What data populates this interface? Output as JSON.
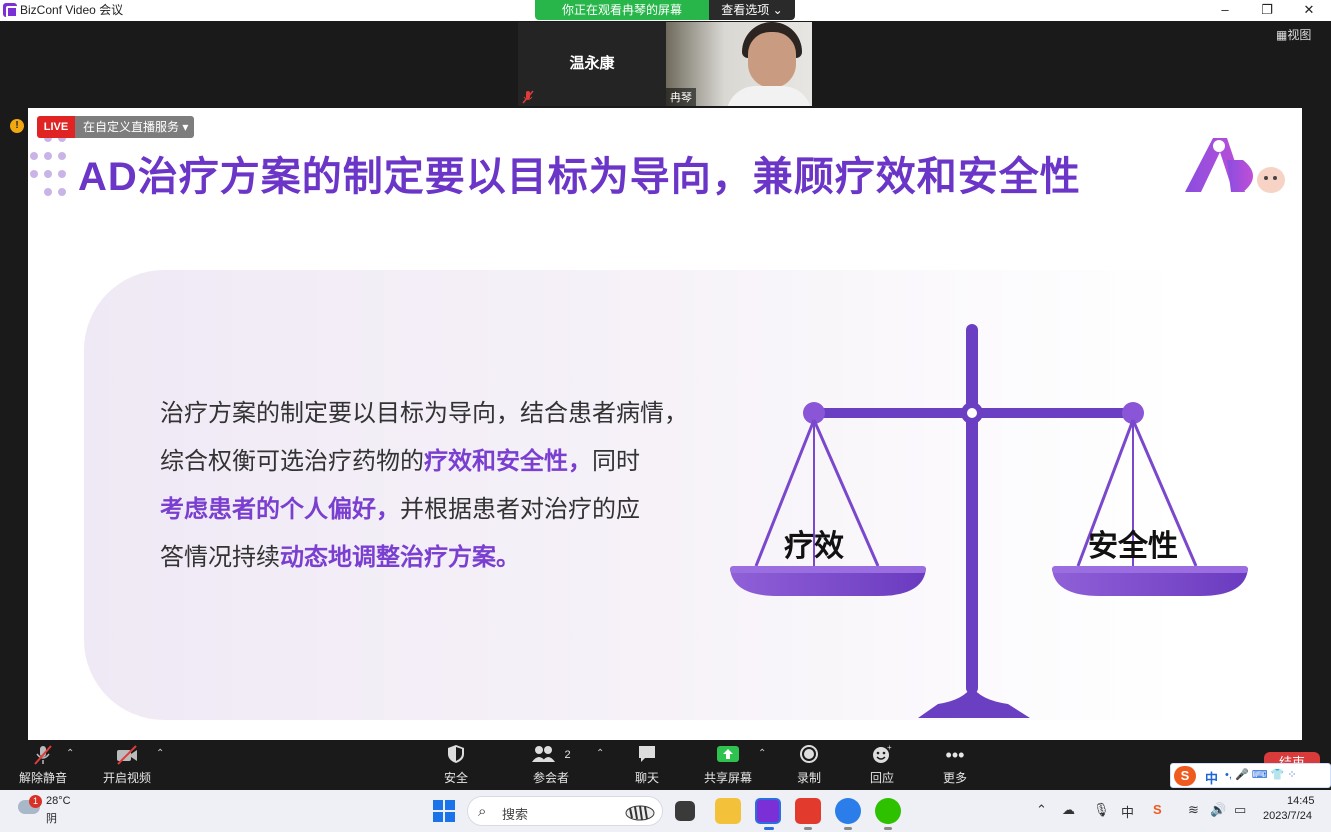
{
  "window": {
    "title": "BizConf Video 会议",
    "minimize": "–",
    "restore": "❐",
    "close": "✕"
  },
  "share_banner": {
    "text": "你正在观看冉琴的屏幕",
    "view_options": "查看选项 ⌄"
  },
  "participants": [
    {
      "name": "温永康",
      "muted": true
    },
    {
      "name": "冉琴",
      "video": true
    }
  ],
  "view_button": "▦视图",
  "live": {
    "badge": "LIVE",
    "service": "在自定义直播服务 ▾"
  },
  "slide": {
    "title": "AD治疗方案的制定要以目标为导向，兼顾疗效和安全性",
    "lines": [
      [
        {
          "t": "治疗方案的制定要以目标为导向，结合患者病情，",
          "hl": false
        }
      ],
      [
        {
          "t": "综合权衡可选治疗药物的",
          "hl": false
        },
        {
          "t": "疗效和安全性，",
          "hl": true
        },
        {
          "t": "同时",
          "hl": false
        }
      ],
      [
        {
          "t": "考虑患者的个人偏好，",
          "hl": true
        },
        {
          "t": "并根据患者对治疗的应",
          "hl": false
        }
      ],
      [
        {
          "t": "答情况持续",
          "hl": false
        },
        {
          "t": "动态地调整治疗方案。",
          "hl": true
        }
      ]
    ],
    "scale_left": "疗效",
    "scale_right": "安全性",
    "accent": "#7a3fd0"
  },
  "toolbar": {
    "mute": "解除静音",
    "video": "开启视频",
    "security": "安全",
    "participants": "参会者",
    "participants_count": "2",
    "chat": "聊天",
    "share": "共享屏幕",
    "record": "录制",
    "reactions": "回应",
    "more": "更多",
    "end": "结束"
  },
  "ime": {
    "logo": "S",
    "mode": "中",
    "items": "•, 🎤 ⌨ 👕 ⁘"
  },
  "taskbar": {
    "weather_temp": "28°C",
    "weather_cond": "阴",
    "weather_badge": "1",
    "search": "搜索",
    "tray_ime": "中",
    "time": "14:45",
    "date": "2023/7/24"
  }
}
